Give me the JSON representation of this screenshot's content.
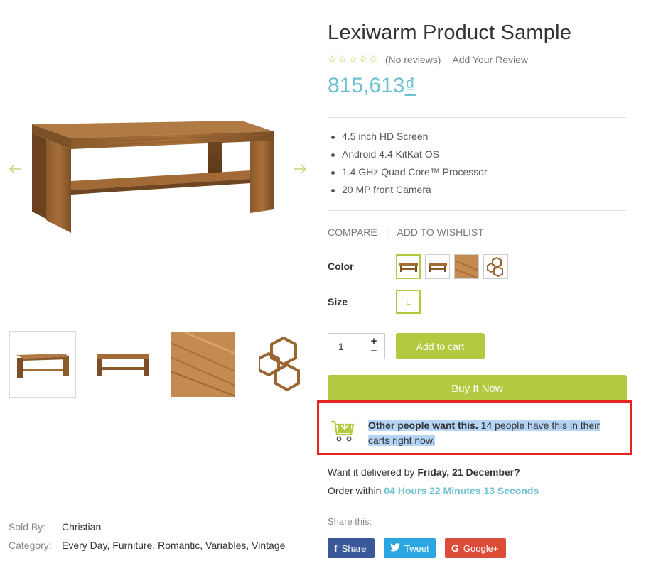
{
  "product": {
    "title": "Lexiwarm Product Sample",
    "review_count": "(No reviews)",
    "add_review": "Add Your Review",
    "price": "815,613",
    "currency": "₫",
    "features": [
      "4.5 inch HD Screen",
      "Android 4.4 KitKat OS",
      "1.4 GHz Quad Core™ Processor",
      "20 MP front Camera"
    ]
  },
  "actions": {
    "compare": "COMPARE",
    "separator": "|",
    "wishlist": "ADD TO WISHLIST"
  },
  "options": {
    "color_label": "Color",
    "size_label": "Size",
    "size_value": "L"
  },
  "cart": {
    "quantity": "1",
    "plus": "+",
    "minus": "−",
    "add_to_cart": "Add to cart",
    "buy_now": "Buy It Now"
  },
  "urgency": {
    "bold": "Other people want this.",
    "text": " 14 people have this in their carts right now."
  },
  "delivery": {
    "prefix": "Want it delivered by ",
    "date": "Friday, 21 December?",
    "order_within": "Order within",
    "hours": "04 Hours",
    "minutes": "22 Minutes",
    "seconds": "13 Seconds"
  },
  "meta": {
    "sold_by_label": "Sold By:",
    "sold_by": "Christian",
    "category_label": "Category:",
    "category": "Every Day, Furniture, Romantic, Variables, Vintage"
  },
  "share": {
    "label": "Share this:",
    "facebook": "Share",
    "twitter": "Tweet",
    "google": "Google+"
  },
  "colors": {
    "accent": "#b4c940",
    "price": "#6cc1d1",
    "highlight_border": "#e7241b",
    "facebook": "#3b5998",
    "twitter": "#2aa6e0",
    "google": "#dd4b39"
  }
}
